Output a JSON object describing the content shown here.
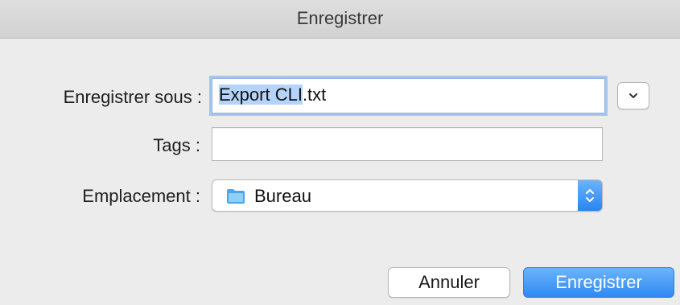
{
  "window": {
    "title": "Enregistrer"
  },
  "form": {
    "save_as_label": "Enregistrer sous :",
    "save_as_selected": "Export CLI",
    "save_as_rest": ".txt",
    "tags_label": "Tags :",
    "tags_value": "",
    "location_label": "Emplacement :",
    "location_value": "Bureau",
    "location_icon": "folder-icon"
  },
  "buttons": {
    "cancel_label": "Annuler",
    "save_label": "Enregistrer"
  },
  "colors": {
    "accent": "#2f89f3",
    "selection": "#b5d4fb",
    "focus_ring": "#a6c6f2",
    "background": "#ececec"
  }
}
